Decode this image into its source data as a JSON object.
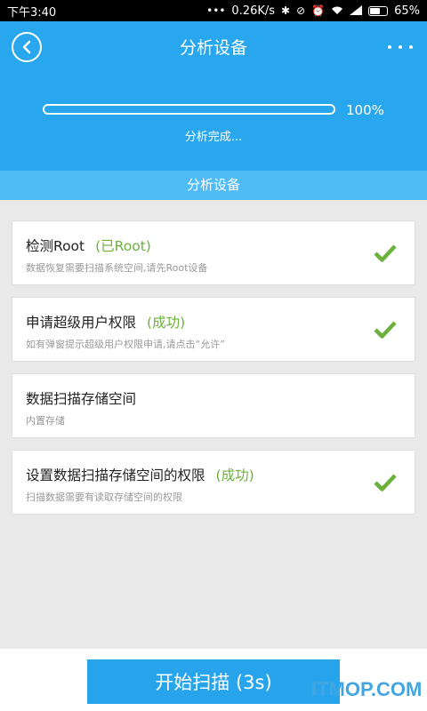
{
  "status_bar": {
    "time": "下午3:40",
    "speed": "0.26K/s",
    "battery_percent": "65%",
    "battery_level": 0.65,
    "icons": [
      "bluetooth-icon",
      "mute-icon",
      "alarm-icon",
      "wifi-icon",
      "signal-icon",
      "battery-icon"
    ]
  },
  "header": {
    "title": "分析设备",
    "back_icon": "back-arrow-icon",
    "more_icon": "more-dots-icon"
  },
  "progress": {
    "value": 1.0,
    "percent_label": "100%",
    "status_text": "分析完成..."
  },
  "section": {
    "title": "分析设备"
  },
  "items": [
    {
      "title": "检测Root",
      "status": "(已Root)",
      "desc": "数据恢复需要扫描系统空间,请先Root设备",
      "checked": true
    },
    {
      "title": "申请超级用户权限",
      "status": "(成功)",
      "desc": "如有弹窗提示超级用户权限申请,请点击“允许”",
      "checked": true
    },
    {
      "title": "数据扫描存储空间",
      "status": "",
      "desc": "内置存储",
      "checked": false
    },
    {
      "title": "设置数据扫描存储空间的权限",
      "status": "(成功)",
      "desc": "扫描数据需要有读取存储空间的权限",
      "checked": true
    }
  ],
  "start_button": {
    "label": "开始扫描 (3s)"
  },
  "watermark": "ITMOP.COM",
  "colors": {
    "header_blue": "#29a7ee",
    "section_blue": "#4fbcf8",
    "success_green": "#6bb13c",
    "button_blue": "#27a4ec"
  }
}
